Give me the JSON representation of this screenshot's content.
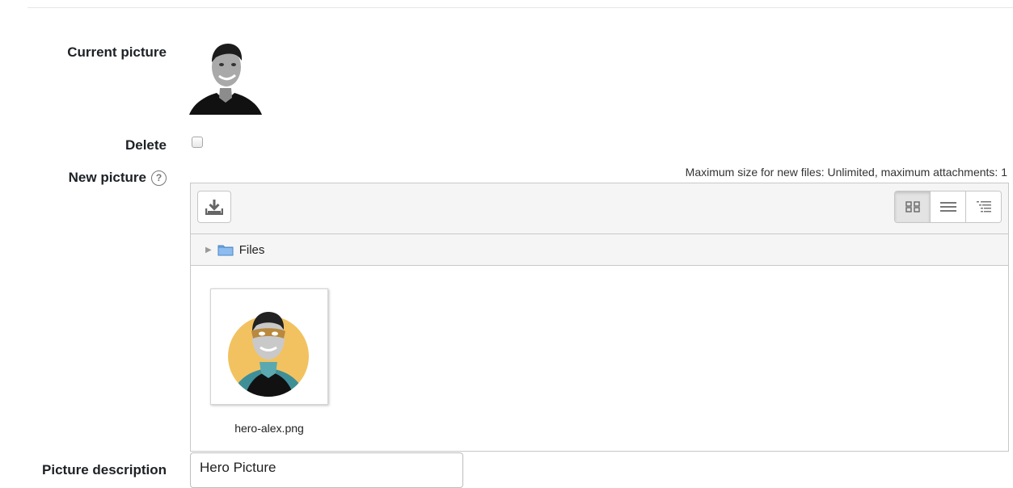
{
  "form": {
    "current_picture_label": "Current picture",
    "delete_label": "Delete",
    "new_picture_label": "New picture",
    "help_glyph": "?",
    "picture_description_label": "Picture description"
  },
  "filemanager": {
    "max_size_text": "Maximum size for new files: Unlimited, maximum attachments: 1",
    "upload_icon": "download-tray-icon",
    "view_modes": [
      "icons",
      "list",
      "tree"
    ],
    "active_view": "icons",
    "path_label": "Files",
    "files": [
      {
        "name": "hero-alex.png"
      }
    ]
  },
  "description_input": {
    "value": "Hero Picture"
  },
  "colors": {
    "folder": "#6aa0de",
    "hero_circle": "#f2c260",
    "hero_shirt": "#3f8f98"
  }
}
